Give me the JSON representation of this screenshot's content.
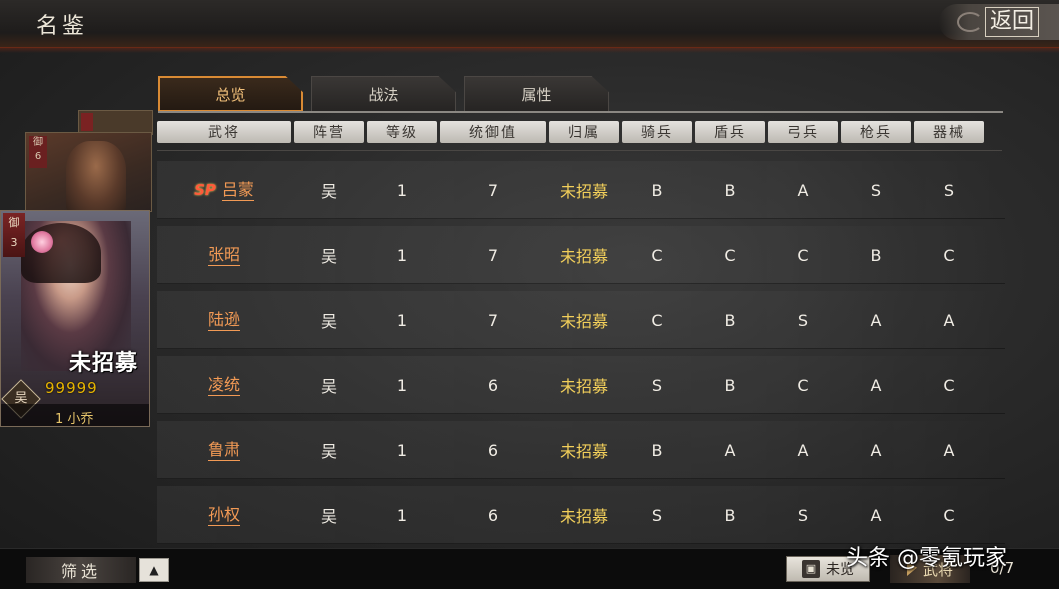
{
  "page_title": "名鉴",
  "back_label": "返回",
  "tabs": [
    {
      "label": "总览",
      "active": true
    },
    {
      "label": "战法",
      "active": false
    },
    {
      "label": "属性",
      "active": false
    }
  ],
  "table": {
    "headers": [
      "武将",
      "阵营",
      "等级",
      "统御值",
      "归属",
      "骑兵",
      "盾兵",
      "弓兵",
      "枪兵",
      "器械"
    ],
    "rows": [
      {
        "sp": "SP",
        "name": "吕蒙",
        "faction": "吴",
        "level": "1",
        "command": "7",
        "status": "未招募",
        "cavalry": "B",
        "shield": "B",
        "archer": "A",
        "spear": "S",
        "siege": "S"
      },
      {
        "sp": "",
        "name": "张昭",
        "faction": "吴",
        "level": "1",
        "command": "7",
        "status": "未招募",
        "cavalry": "C",
        "shield": "C",
        "archer": "C",
        "spear": "B",
        "siege": "C"
      },
      {
        "sp": "",
        "name": "陆逊",
        "faction": "吴",
        "level": "1",
        "command": "7",
        "status": "未招募",
        "cavalry": "C",
        "shield": "B",
        "archer": "S",
        "spear": "A",
        "siege": "A"
      },
      {
        "sp": "",
        "name": "凌统",
        "faction": "吴",
        "level": "1",
        "command": "6",
        "status": "未招募",
        "cavalry": "S",
        "shield": "B",
        "archer": "C",
        "spear": "A",
        "siege": "C"
      },
      {
        "sp": "",
        "name": "鲁肃",
        "faction": "吴",
        "level": "1",
        "command": "6",
        "status": "未招募",
        "cavalry": "B",
        "shield": "A",
        "archer": "A",
        "spear": "A",
        "siege": "A"
      },
      {
        "sp": "",
        "name": "孙权",
        "faction": "吴",
        "level": "1",
        "command": "6",
        "status": "未招募",
        "cavalry": "S",
        "shield": "B",
        "archer": "S",
        "spear": "A",
        "siege": "C"
      }
    ]
  },
  "card_stack": {
    "back_card_tag": "御\n6",
    "main_card": {
      "rank_tag": "御\n3",
      "status": "未招募",
      "stars": "99999",
      "faction": "吴",
      "name": "1 小乔"
    }
  },
  "bottom": {
    "filter_label": "筛选",
    "filter_toggle_icon": "triangle-up-icon",
    "recruit_label": "未览",
    "general_label": "武将",
    "general_count": "0/7"
  },
  "watermark": "头条 @零氪玩家",
  "colors": {
    "accent_orange": "#d98a34",
    "name_orange": "#f29a55",
    "status_yellow": "#f2cf5a",
    "sp_red": "#ff5a3a"
  }
}
